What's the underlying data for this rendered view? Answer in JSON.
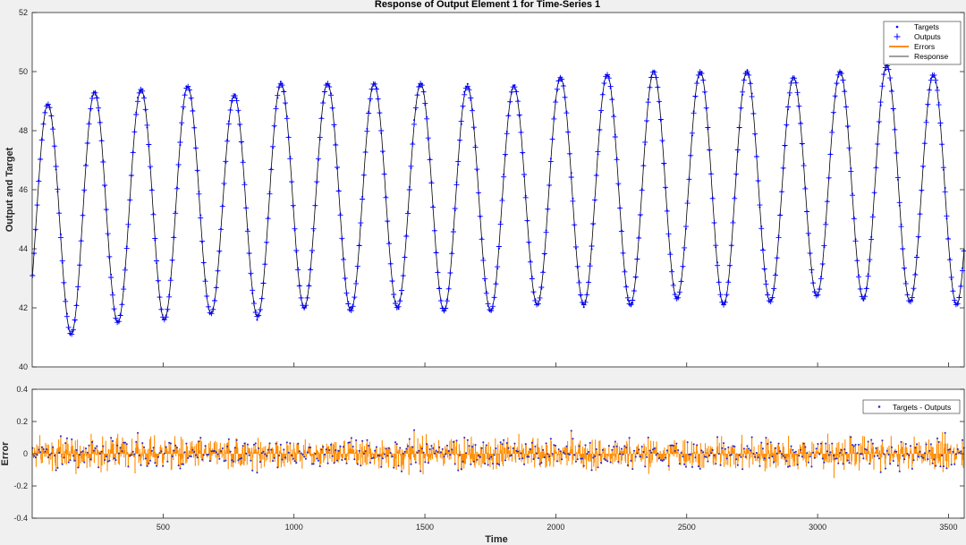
{
  "chart_data": [
    {
      "type": "line",
      "title": "Response of Output Element 1 for Time-Series 1",
      "xlabel": "",
      "ylabel": "Output and Target",
      "xlim": [
        0,
        3560
      ],
      "ylim": [
        40,
        52
      ],
      "yticks": [
        40,
        42,
        44,
        46,
        48,
        50,
        52
      ],
      "xticks": [],
      "grid": false,
      "legend_position": "top-right",
      "legend": [
        "Targets",
        "Outputs",
        "Errors",
        "Response"
      ],
      "signal": {
        "period": 178,
        "peaks": [
          48.9,
          49.3,
          49.4,
          49.5,
          49.2,
          49.6,
          49.6,
          49.6,
          49.6,
          49.5,
          49.5,
          49.8,
          49.9,
          50.0,
          50.0,
          50.0,
          49.8,
          50.0,
          50.2,
          49.9,
          50.2
        ],
        "troughs": [
          41.1,
          41.5,
          41.6,
          41.8,
          41.7,
          42.0,
          41.9,
          42.0,
          41.9,
          41.9,
          42.1,
          42.1,
          42.1,
          42.3,
          42.1,
          42.2,
          42.4,
          42.3,
          42.2,
          42.1
        ]
      },
      "colors": {
        "targets": "#0000ff",
        "outputs": "#0000ff",
        "errors": "#ff8c00",
        "response": "#000000"
      }
    },
    {
      "type": "line",
      "title": "",
      "xlabel": "Time",
      "ylabel": "Error",
      "xlim": [
        0,
        3560
      ],
      "ylim": [
        -0.4,
        0.4
      ],
      "yticks": [
        -0.4,
        -0.2,
        0,
        0.2,
        0.4
      ],
      "xticks": [
        500,
        1000,
        1500,
        2000,
        2500,
        3000,
        3500
      ],
      "grid": false,
      "legend_position": "top-right",
      "legend": [
        "Targets - Outputs"
      ],
      "error_spread": 0.1,
      "colors": {
        "errors": "#ff8c00",
        "points": "#2a2acc"
      }
    }
  ]
}
